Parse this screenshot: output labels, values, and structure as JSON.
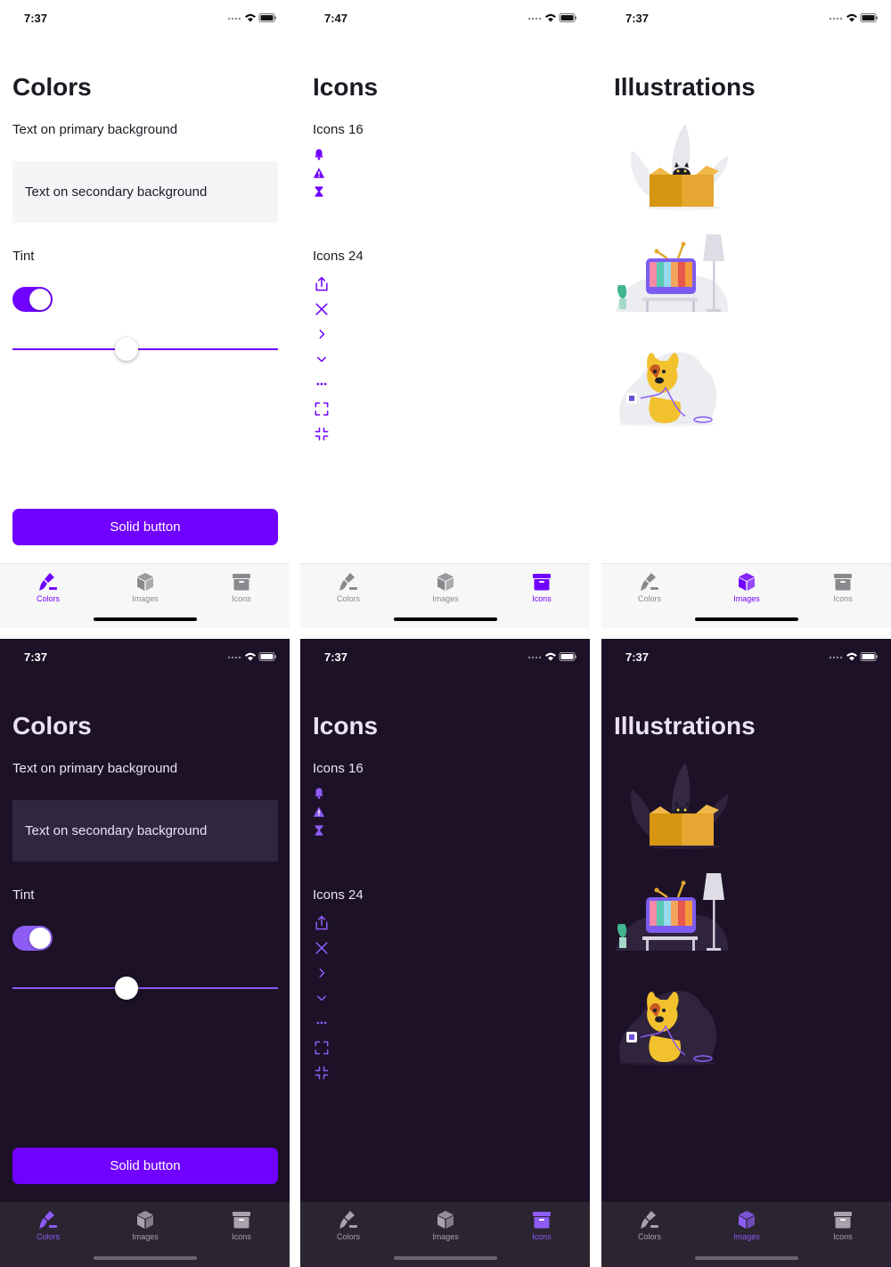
{
  "status_bar": {
    "times": [
      "7:37",
      "7:47",
      "7:37",
      "7:37",
      "7:37",
      "7:37"
    ]
  },
  "colors_screen": {
    "title": "Colors",
    "primary_text": "Text on primary background",
    "secondary_text": "Text on secondary background",
    "tint_label": "Tint",
    "toggle_on": true,
    "slider_value": 0.43,
    "button_label": "Solid button"
  },
  "icons_screen": {
    "title": "Icons",
    "icons16_label": "Icons 16",
    "icons16": [
      "bell-icon",
      "warning-icon",
      "hourglass-icon"
    ],
    "icons24_label": "Icons 24",
    "icons24": [
      "share-icon",
      "close-icon",
      "chevron-right-icon",
      "chevron-down-icon",
      "more-icon",
      "fullscreen-icon",
      "exit-fullscreen-icon"
    ]
  },
  "illustrations_screen": {
    "title": "Illustrations",
    "illustrations": [
      "cat-in-box-illustration",
      "tv-and-lamp-illustration",
      "dog-with-cable-illustration"
    ]
  },
  "tab_bar": {
    "tabs": [
      {
        "label": "Colors",
        "icon": "brush-icon"
      },
      {
        "label": "Images",
        "icon": "cube-icon"
      },
      {
        "label": "Icons",
        "icon": "archive-icon"
      }
    ]
  },
  "theme": {
    "accent_light": "#7000ff",
    "accent_dark": "#8d5cf5",
    "dark_background": "#1c1127",
    "dark_secondary": "#302640"
  }
}
